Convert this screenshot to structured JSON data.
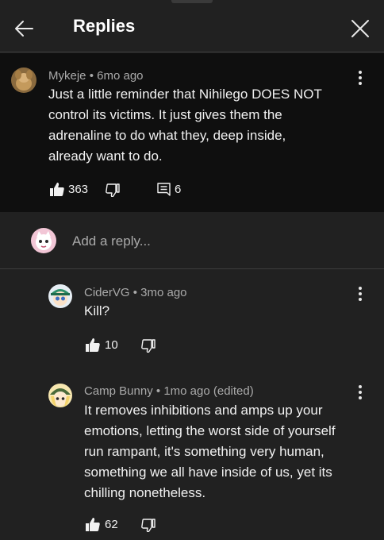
{
  "header": {
    "title": "Replies",
    "back_icon": "arrow-left-icon",
    "close_icon": "close-icon"
  },
  "parent_comment": {
    "author": "Mykeje",
    "time": "6mo ago",
    "text": "Just a little reminder that Nihilego DOES NOT control its victims. It just gives them the adrenaline to do what they, deep inside, already want to do.",
    "likes": "363",
    "replies": "6"
  },
  "composer": {
    "placeholder": "Add a reply..."
  },
  "replies": [
    {
      "author": "CiderVG",
      "time": "3mo ago",
      "text": "Kill?",
      "likes": "10"
    },
    {
      "author": "Camp Bunny",
      "time": "1mo ago (edited)",
      "text": "It removes inhibitions and amps up your emotions, letting the worst side of yourself run rampant, it's something very human, something we all have inside of us, yet its chilling nonetheless.",
      "likes": "62"
    }
  ],
  "separator": "•",
  "colors": {
    "background": "#212121",
    "highlight": "#0f0f0f",
    "text": "#f1f1f1",
    "meta": "#aaaaaa"
  }
}
